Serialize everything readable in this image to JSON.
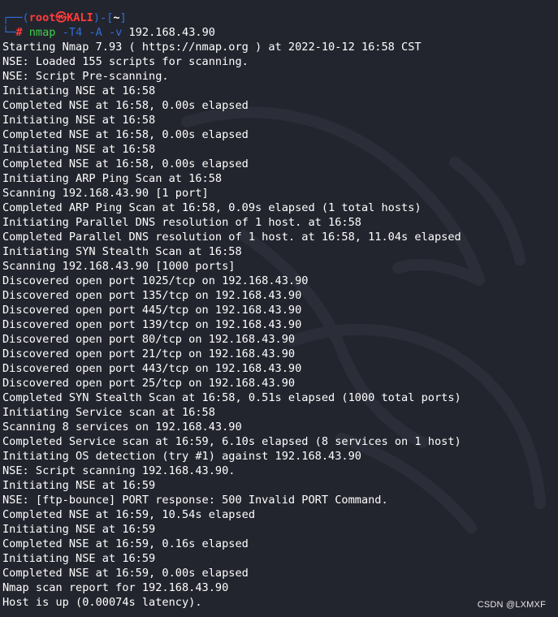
{
  "prompt": {
    "line1_open": "┌──(",
    "user": "root㉿KALI",
    "line1_mid": ")-[",
    "dir": "~",
    "line1_close": "]",
    "line2_corner": "└─",
    "hash": "#",
    "command": "nmap",
    "flags": "-T4 -A -v",
    "target": "192.168.43.90"
  },
  "output": [
    "Starting Nmap 7.93 ( https://nmap.org ) at 2022-10-12 16:58 CST",
    "NSE: Loaded 155 scripts for scanning.",
    "NSE: Script Pre-scanning.",
    "Initiating NSE at 16:58",
    "Completed NSE at 16:58, 0.00s elapsed",
    "Initiating NSE at 16:58",
    "Completed NSE at 16:58, 0.00s elapsed",
    "Initiating NSE at 16:58",
    "Completed NSE at 16:58, 0.00s elapsed",
    "Initiating ARP Ping Scan at 16:58",
    "Scanning 192.168.43.90 [1 port]",
    "Completed ARP Ping Scan at 16:58, 0.09s elapsed (1 total hosts)",
    "Initiating Parallel DNS resolution of 1 host. at 16:58",
    "Completed Parallel DNS resolution of 1 host. at 16:58, 11.04s elapsed",
    "Initiating SYN Stealth Scan at 16:58",
    "Scanning 192.168.43.90 [1000 ports]",
    "Discovered open port 1025/tcp on 192.168.43.90",
    "Discovered open port 135/tcp on 192.168.43.90",
    "Discovered open port 445/tcp on 192.168.43.90",
    "Discovered open port 139/tcp on 192.168.43.90",
    "Discovered open port 80/tcp on 192.168.43.90",
    "Discovered open port 21/tcp on 192.168.43.90",
    "Discovered open port 443/tcp on 192.168.43.90",
    "Discovered open port 25/tcp on 192.168.43.90",
    "Completed SYN Stealth Scan at 16:58, 0.51s elapsed (1000 total ports)",
    "Initiating Service scan at 16:58",
    "Scanning 8 services on 192.168.43.90",
    "Completed Service scan at 16:59, 6.10s elapsed (8 services on 1 host)",
    "Initiating OS detection (try #1) against 192.168.43.90",
    "NSE: Script scanning 192.168.43.90.",
    "Initiating NSE at 16:59",
    "NSE: [ftp-bounce] PORT response: 500 Invalid PORT Command.",
    "Completed NSE at 16:59, 10.54s elapsed",
    "Initiating NSE at 16:59",
    "Completed NSE at 16:59, 0.16s elapsed",
    "Initiating NSE at 16:59",
    "Completed NSE at 16:59, 0.00s elapsed",
    "Nmap scan report for 192.168.43.90",
    "Host is up (0.00074s latency)."
  ],
  "watermark": "CSDN @LXMXF",
  "colors": {
    "background": "#23252e",
    "text": "#ffffff",
    "prompt_frame": "#2f6ed8",
    "prompt_user": "#ff3b3b",
    "command": "#3dd24a",
    "flags": "#2f6ed8"
  }
}
